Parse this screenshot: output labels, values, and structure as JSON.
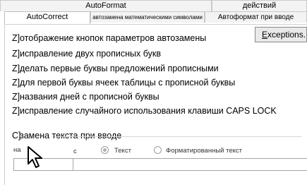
{
  "tabs_row1": [
    {
      "label": "AutoFormat"
    },
    {
      "label": "действий"
    }
  ],
  "tabs_row2": [
    {
      "label": "AutoCorrect"
    },
    {
      "label": "автозамена математическими символами"
    },
    {
      "label": "Автоформат при вводе"
    }
  ],
  "options": [
    {
      "mark": "Z]",
      "label": "отображение кнопок параметров автозамены"
    },
    {
      "mark": "Z]",
      "label": "исправление двух прописных букв"
    },
    {
      "mark": "Z]",
      "label": "делать первые буквы предложений прописными"
    },
    {
      "mark": "Z]",
      "label": "для первой буквы ячеек таблицы с прописной буквы"
    },
    {
      "mark": "Z]",
      "label": "названия дней с прописной буквы"
    },
    {
      "mark": "Z]",
      "label": "исправление случайного использования клавиши CAPS LOCK"
    }
  ],
  "exceptions_button": {
    "label_underlined": "E",
    "label_rest": "xceptions..."
  },
  "replace_section": {
    "mark": "C]",
    "title": "замена текста при вводе",
    "replace_label": "на",
    "with_label": "с",
    "radio_plain": "Текст",
    "radio_formatted": "Форматированный текст"
  },
  "icons": {
    "cursor": "mouse-pointer-icon"
  }
}
